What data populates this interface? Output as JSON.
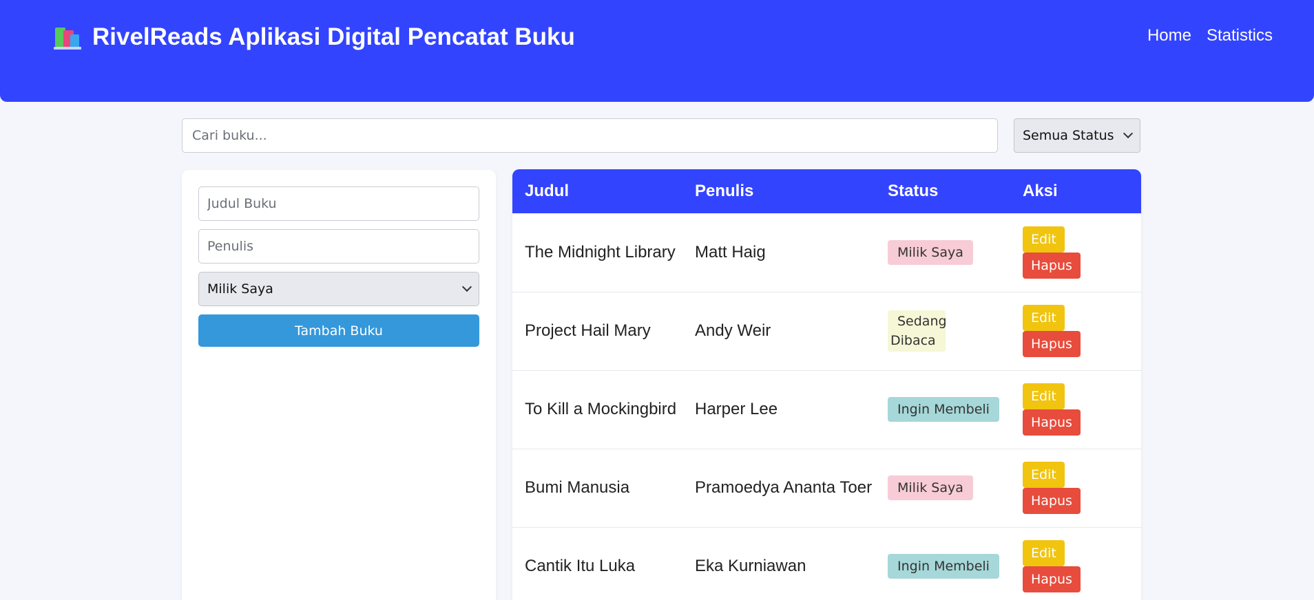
{
  "header": {
    "title": "RivelReads Aplikasi Digital Pencatat Buku",
    "logo_icon": "books-icon",
    "nav": [
      "Home",
      "Statistics"
    ]
  },
  "search": {
    "placeholder": "Cari buku..."
  },
  "filter": {
    "selected": "Semua Status"
  },
  "form": {
    "title_placeholder": "Judul Buku",
    "author_placeholder": "Penulis",
    "status_selected": "Milik Saya",
    "submit_label": "Tambah Buku"
  },
  "table": {
    "headers": [
      "Judul",
      "Penulis",
      "Status",
      "Aksi"
    ],
    "edit_label": "Edit",
    "delete_label": "Hapus",
    "rows": [
      {
        "title": "The Midnight Library",
        "author": "Matt Haig",
        "status": "Milik Saya"
      },
      {
        "title": "Project Hail Mary",
        "author": "Andy Weir",
        "status": "Sedang Dibaca"
      },
      {
        "title": "To Kill a Mockingbird",
        "author": "Harper Lee",
        "status": "Ingin Membeli"
      },
      {
        "title": "Bumi Manusia",
        "author": "Pramoedya Ananta Toer",
        "status": "Milik Saya"
      },
      {
        "title": "Cantik Itu Luka",
        "author": "Eka Kurniawan",
        "status": "Ingin Membeli"
      }
    ]
  },
  "colors": {
    "primary": "#3344ff",
    "add_button": "#3498db",
    "edit_button": "#f1c40f",
    "delete_button": "#e74c3c",
    "status_milik": "#f7ccd6",
    "status_sedang": "#f5f7d6",
    "status_ingin": "#a6d7d9"
  }
}
